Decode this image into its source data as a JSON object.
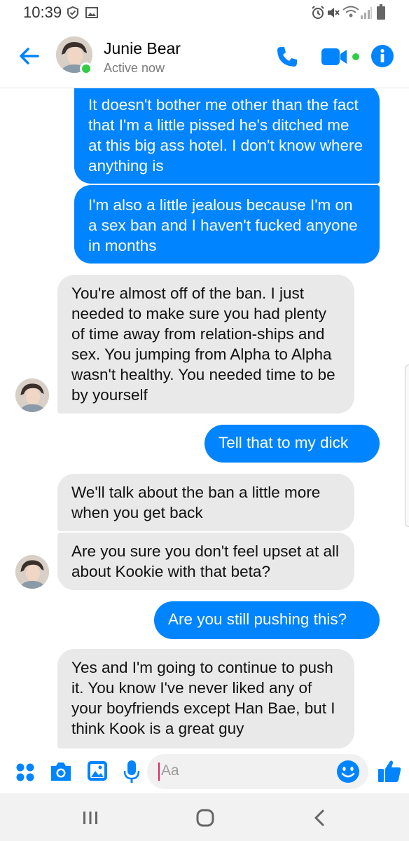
{
  "status_bar": {
    "time": "10:39",
    "icons": [
      "shield-check-icon",
      "image-icon",
      "alarm-icon",
      "mute-icon",
      "wifi-icon",
      "signal-icon",
      "battery-icon"
    ]
  },
  "header": {
    "contact_name": "Junie Bear",
    "status": "Active now",
    "accent_color": "#0084ff",
    "active_color": "#31cc46",
    "icons": [
      "back-arrow-icon",
      "phone-icon",
      "video-camera-icon",
      "info-icon"
    ]
  },
  "messages": [
    {
      "dir": "out",
      "text": "It doesn't bother me other than the fact that I'm a little pissed he's ditched me at this big ass hotel. I don't know where anything is"
    },
    {
      "dir": "out",
      "text": "I'm also a little jealous because I'm on a sex ban and I haven't fucked anyone in months"
    },
    {
      "dir": "in",
      "text": "You're almost off of the ban. I just needed to make sure you had plenty of time away from relation-ships and sex. You jumping from Alpha to Alpha wasn't healthy. You needed time to be by yourself"
    },
    {
      "dir": "out",
      "text": "Tell that to my dick"
    },
    {
      "dir": "in",
      "text": "We'll talk about the ban a little more when you get back"
    },
    {
      "dir": "in",
      "text": "Are you sure you don't feel upset at all about Kookie with that beta?"
    },
    {
      "dir": "out",
      "text": "Are you still pushing this?"
    },
    {
      "dir": "in",
      "text": "Yes and I'm going to continue to push it. You know I've never liked any of your boyfriends except Han Bae, but I think Kook is a great guy"
    }
  ],
  "composer": {
    "placeholder": "Aa",
    "icons": [
      "apps-icon",
      "camera-icon",
      "gallery-icon",
      "microphone-icon",
      "emoji-icon",
      "thumbs-up-icon"
    ]
  },
  "nav_bar": {
    "icons": [
      "recent-apps-icon",
      "home-icon",
      "back-icon"
    ]
  }
}
